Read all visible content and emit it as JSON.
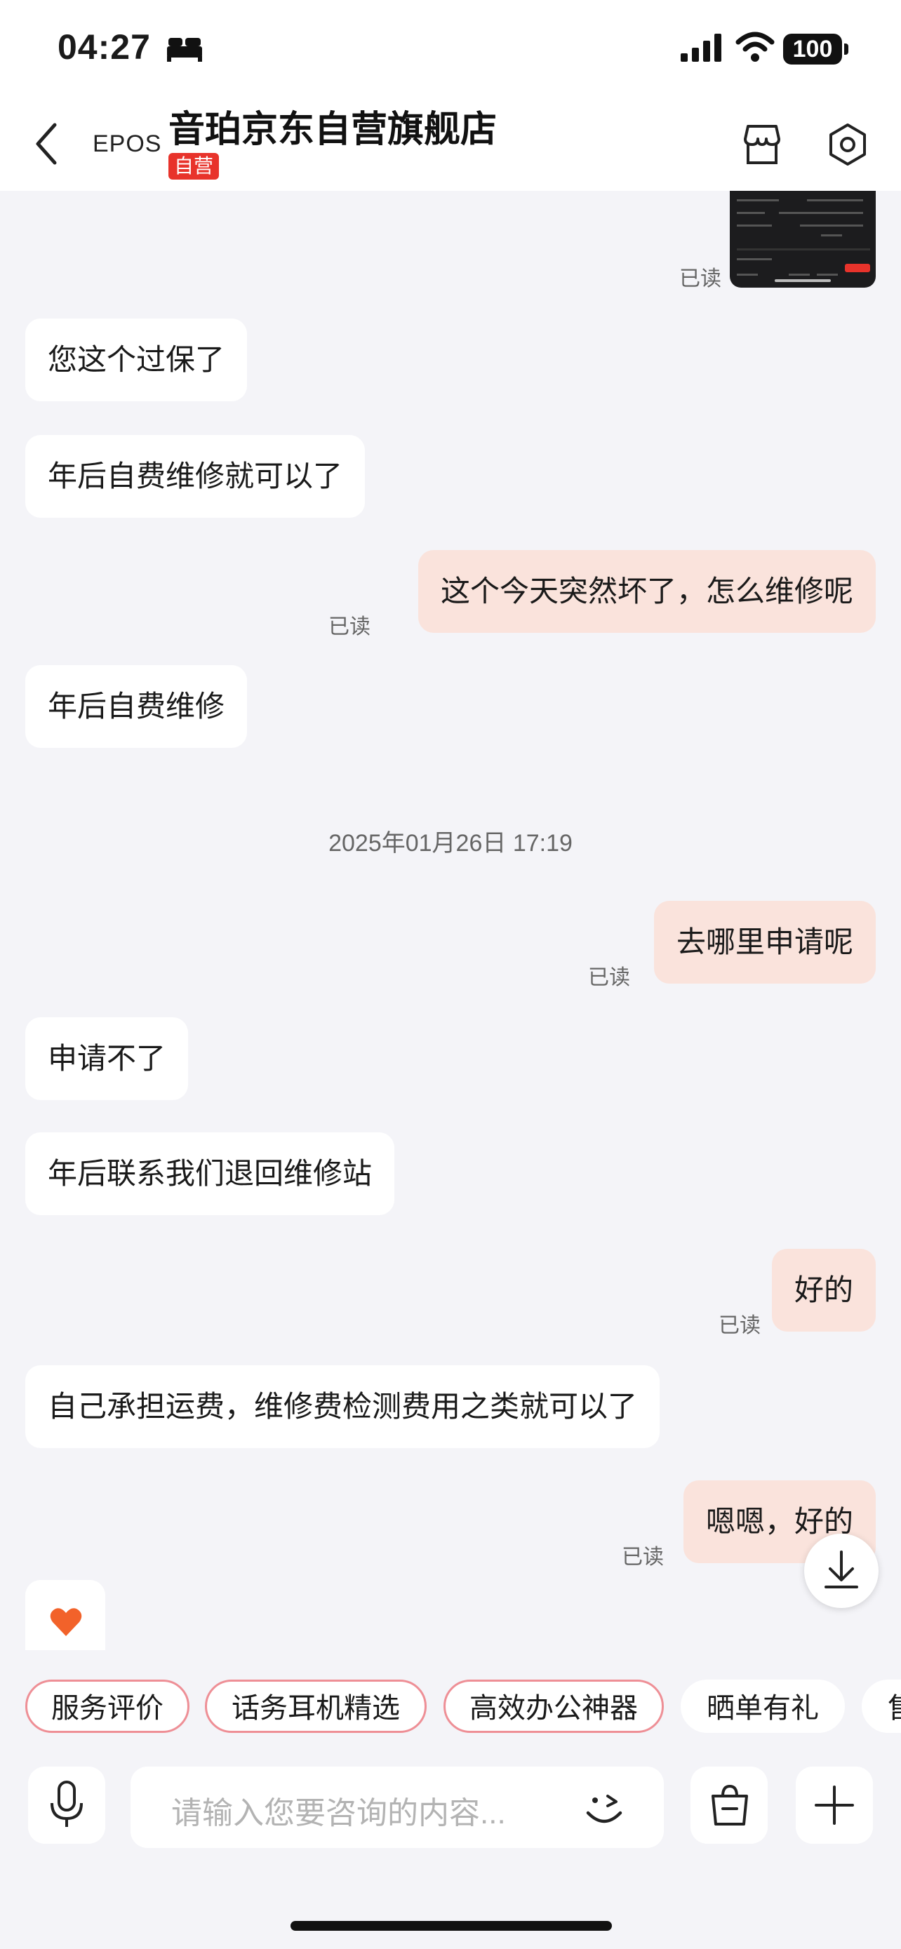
{
  "status_bar": {
    "time": "04:27",
    "battery": "100"
  },
  "header": {
    "brand_logo": "EPOS",
    "store_name": "音珀京东自营旗舰店",
    "badge": "自营"
  },
  "messages": [
    {
      "side": "out",
      "type": "image",
      "read": "已读"
    },
    {
      "side": "in",
      "text": "您这个过保了"
    },
    {
      "side": "in",
      "text": "年后自费维修就可以了"
    },
    {
      "side": "out",
      "text": "这个今天突然坏了，怎么维修呢",
      "read": "已读"
    },
    {
      "side": "in",
      "text": "年后自费维修"
    },
    {
      "type": "timestamp",
      "text": "2025年01月26日 17:19"
    },
    {
      "side": "out",
      "text": "去哪里申请呢",
      "read": "已读"
    },
    {
      "side": "in",
      "text": "申请不了"
    },
    {
      "side": "in",
      "text": "年后联系我们退回维修站"
    },
    {
      "side": "out",
      "text": "好的",
      "read": "已读"
    },
    {
      "side": "in",
      "text": "自己承担运费，维修费检测费用之类就可以了"
    },
    {
      "side": "out",
      "text": "嗯嗯，好的",
      "read": "已读"
    },
    {
      "side": "in",
      "type": "emoji",
      "icon": "heart-icon"
    }
  ],
  "quick_replies": [
    "服务评价",
    "话务耳机精选",
    "高效办公神器",
    "晒单有礼",
    "售"
  ],
  "input": {
    "placeholder": "请输入您要咨询的内容..."
  },
  "colors": {
    "out_bubble": "#fae3dc",
    "in_bubble": "#ffffff",
    "accent": "#e8332b",
    "background": "#f4f4f8"
  }
}
